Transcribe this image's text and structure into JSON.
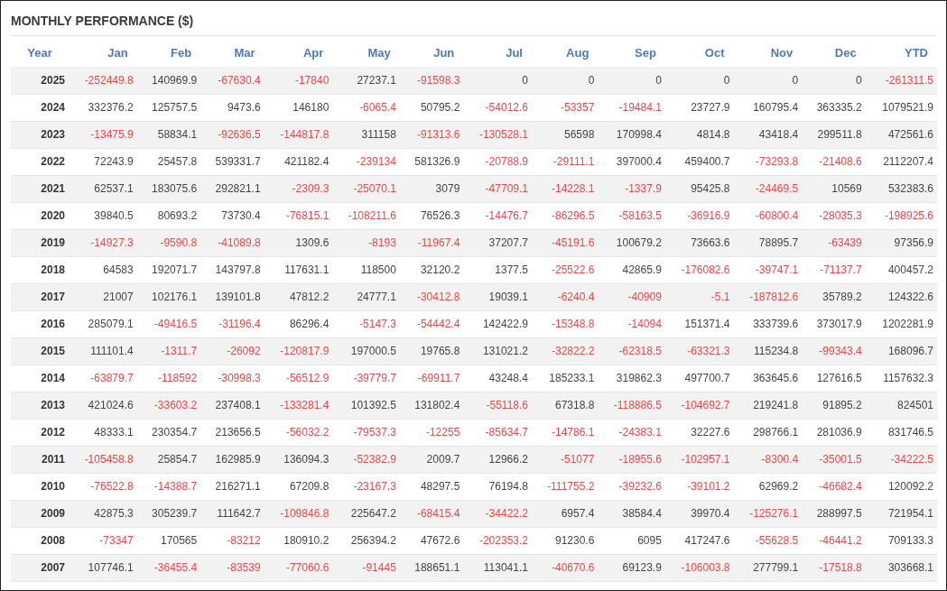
{
  "title": "MONTHLY PERFORMANCE ($)",
  "table": {
    "columns": [
      "Year",
      "Jan",
      "Feb",
      "Mar",
      "Apr",
      "May",
      "Jun",
      "Jul",
      "Aug",
      "Sep",
      "Oct",
      "Nov",
      "Dec",
      "YTD"
    ],
    "rows": [
      [
        "2025",
        "-252449.8",
        "140969.9",
        "-67630.4",
        "-17840",
        "27237.1",
        "-91598.3",
        "0",
        "0",
        "0",
        "0",
        "0",
        "0",
        "-261311.5"
      ],
      [
        "2024",
        "332376.2",
        "125757.5",
        "9473.6",
        "146180",
        "-6065.4",
        "50795.2",
        "-54012.6",
        "-53357",
        "-19484.1",
        "23727.9",
        "160795.4",
        "363335.2",
        "1079521.9"
      ],
      [
        "2023",
        "-13475.9",
        "58834.1",
        "-92636.5",
        "-144817.8",
        "311158",
        "-91313.6",
        "-130528.1",
        "56598",
        "170998.4",
        "4814.8",
        "43418.4",
        "299511.8",
        "472561.6"
      ],
      [
        "2022",
        "72243.9",
        "25457.8",
        "539331.7",
        "421182.4",
        "-239134",
        "581326.9",
        "-20788.9",
        "-29111.1",
        "397000.4",
        "459400.7",
        "-73293.8",
        "-21408.6",
        "2112207.4"
      ],
      [
        "2021",
        "62537.1",
        "183075.6",
        "292821.1",
        "-2309.3",
        "-25070.1",
        "3079",
        "-47709.1",
        "-14228.1",
        "-1337.9",
        "95425.8",
        "-24469.5",
        "10569",
        "532383.6"
      ],
      [
        "2020",
        "39840.5",
        "80693.2",
        "73730.4",
        "-76815.1",
        "-108211.6",
        "76526.3",
        "-14476.7",
        "-86296.5",
        "-58163.5",
        "-36916.9",
        "-60800.4",
        "-28035.3",
        "-198925.6"
      ],
      [
        "2019",
        "-14927.3",
        "-9590.8",
        "-41089.8",
        "1309.6",
        "-8193",
        "-11967.4",
        "37207.7",
        "-45191.6",
        "100679.2",
        "73663.6",
        "78895.7",
        "-63439",
        "97356.9"
      ],
      [
        "2018",
        "64583",
        "192071.7",
        "143797.8",
        "117631.1",
        "118500",
        "32120.2",
        "1377.5",
        "-25522.6",
        "42865.9",
        "-176082.6",
        "-39747.1",
        "-71137.7",
        "400457.2"
      ],
      [
        "2017",
        "21007",
        "102176.1",
        "139101.8",
        "47812.2",
        "24777.1",
        "-30412.8",
        "19039.1",
        "-6240.4",
        "-40909",
        "-5.1",
        "-187812.6",
        "35789.2",
        "124322.6"
      ],
      [
        "2016",
        "285079.1",
        "-49416.5",
        "-31196.4",
        "86296.4",
        "-5147.3",
        "-54442.4",
        "142422.9",
        "-15348.8",
        "-14094",
        "151371.4",
        "333739.6",
        "373017.9",
        "1202281.9"
      ],
      [
        "2015",
        "111101.4",
        "-1311.7",
        "-26092",
        "-120817.9",
        "197000.5",
        "19765.8",
        "131021.2",
        "-32822.2",
        "-62318.5",
        "-63321.3",
        "115234.8",
        "-99343.4",
        "168096.7"
      ],
      [
        "2014",
        "-63879.7",
        "-118592",
        "-30998.3",
        "-56512.9",
        "-39779.7",
        "-69911.7",
        "43248.4",
        "185233.1",
        "319862.3",
        "497700.7",
        "363645.6",
        "127616.5",
        "1157632.3"
      ],
      [
        "2013",
        "421024.6",
        "-33603.2",
        "237408.1",
        "-133281.4",
        "101392.5",
        "131802.4",
        "-55118.6",
        "67318.8",
        "-118886.5",
        "-104692.7",
        "219241.8",
        "91895.2",
        "824501"
      ],
      [
        "2012",
        "48333.1",
        "230354.7",
        "213656.5",
        "-56032.2",
        "-79537.3",
        "-12255",
        "-85634.7",
        "-14786.1",
        "-24383.1",
        "32227.6",
        "298766.1",
        "281036.9",
        "831746.5"
      ],
      [
        "2011",
        "-105458.8",
        "25854.7",
        "162985.9",
        "136094.3",
        "-52382.9",
        "2009.7",
        "12966.2",
        "-51077",
        "-18955.6",
        "-102957.1",
        "-8300.4",
        "-35001.5",
        "-34222.5"
      ],
      [
        "2010",
        "-76522.8",
        "-14388.7",
        "216271.1",
        "67209.8",
        "-23167.3",
        "48297.5",
        "76194.8",
        "-111755.2",
        "-39232.6",
        "-39101.2",
        "62969.2",
        "-46682.4",
        "120092.2"
      ],
      [
        "2009",
        "42875.3",
        "305239.7",
        "111642.7",
        "-109846.8",
        "225647.2",
        "-68415.4",
        "-34422.2",
        "6957.4",
        "38584.4",
        "39970.4",
        "-125276.1",
        "288997.5",
        "721954.1"
      ],
      [
        "2008",
        "-73347",
        "170565",
        "-83212",
        "180910.2",
        "256394.2",
        "47672.6",
        "-202353.2",
        "91230.6",
        "6095",
        "417247.6",
        "-55628.5",
        "-46441.2",
        "709133.3"
      ],
      [
        "2007",
        "107746.1",
        "-36455.4",
        "-83539",
        "-77060.6",
        "-91445",
        "188651.1",
        "113041.1",
        "-40670.6",
        "69123.9",
        "-106003.8",
        "277799.1",
        "-17518.8",
        "303668.1"
      ]
    ]
  }
}
